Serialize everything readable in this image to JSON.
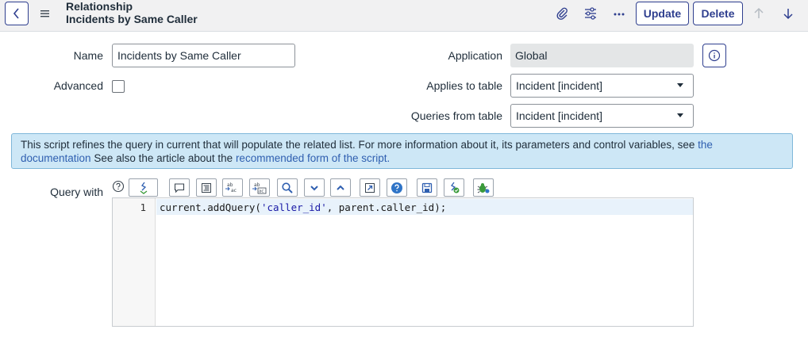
{
  "header": {
    "record_type": "Relationship",
    "record_name": "Incidents by Same Caller",
    "update_label": "Update",
    "delete_label": "Delete"
  },
  "form": {
    "name_label": "Name",
    "name_value": "Incidents by Same Caller",
    "advanced_label": "Advanced",
    "advanced_checked": false,
    "application_label": "Application",
    "application_value": "Global",
    "applies_to_label": "Applies to table",
    "applies_to_value": "Incident [incident]",
    "queries_from_label": "Queries from table",
    "queries_from_value": "Incident [incident]",
    "query_with_label": "Query with"
  },
  "banner": {
    "text_before": "This script refines the query in current that will populate the related list. For more information about it, its parameters and control variables, see ",
    "link1": "the documentation",
    "text_middle": " See also the article about the ",
    "link2": "recommended form of the script."
  },
  "editor": {
    "line_number": "1",
    "code_prefix": "current.addQuery(",
    "code_string": "'caller_id'",
    "code_suffix": ", parent.caller_id);"
  },
  "colors": {
    "accent": "#2f3f8f",
    "banner_bg": "#cde7f6",
    "link": "#2f5fb0"
  }
}
